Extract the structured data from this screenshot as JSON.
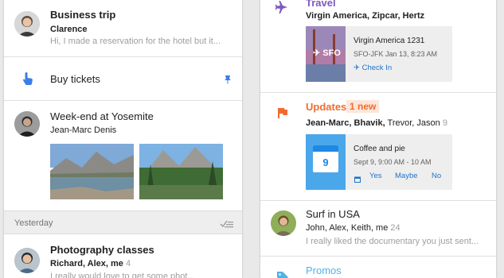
{
  "left": {
    "items": [
      {
        "title": "Business trip",
        "sender": "Clarence",
        "snippet": "Hi, I made a reservation for the hotel but it..."
      },
      {
        "title": "Buy tickets"
      },
      {
        "title": "Week-end at Yosemite",
        "sender": "Jean-Marc Denis"
      }
    ],
    "section_label": "Yesterday",
    "photography": {
      "title": "Photography classes",
      "senders": "Richard, Alex, me",
      "count": "4",
      "snippet": "I really would love to get some phot..."
    }
  },
  "right": {
    "travel": {
      "label": "Travel",
      "senders": "Virgin America, Zipcar, Hertz",
      "card": {
        "thumb_label": "SFO",
        "flight": "Virgin America 1231",
        "details": "SFO-JFK Jan 13, 8:23 AM",
        "action": "Check In"
      }
    },
    "updates": {
      "label": "Updates",
      "badge": "1 new",
      "senders_bold": "Jean-Marc, Bhavik,",
      "senders_rest": " Trevor, Jason",
      "count": "9",
      "card": {
        "day": "9",
        "title": "Coffee and pie",
        "when": "Sept 9, 9:00 AM - 10 AM",
        "yes": "Yes",
        "maybe": "Maybe",
        "no": "No"
      }
    },
    "surf": {
      "title": "Surf in USA",
      "senders": "John, Alex, Keith, me",
      "count": "24",
      "snippet": "I really liked the documentary you just sent..."
    },
    "promos": {
      "label": "Promos"
    }
  },
  "colors": {
    "travel": "#7e57c2",
    "updates": "#ef6c2f",
    "promos": "#4fb3e8",
    "link": "#1e73c8",
    "reminder": "#3b7ded"
  }
}
